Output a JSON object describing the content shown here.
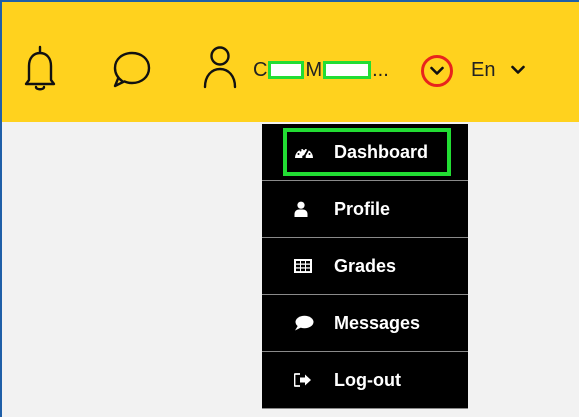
{
  "header": {
    "icons": {
      "notifications": "bell-icon",
      "messages": "speech-bubble-icon",
      "user": "user-icon"
    },
    "user_name_first_initial": "C",
    "user_name_last_initial": "M",
    "user_name_ellipsis": "...",
    "user_dropdown_icon": "chevron-down-icon",
    "language": "En",
    "language_dropdown_icon": "chevron-down-icon"
  },
  "menu": {
    "items": [
      {
        "label": "Dashboard",
        "icon": "dashboard-icon"
      },
      {
        "label": "Profile",
        "icon": "user-icon"
      },
      {
        "label": "Grades",
        "icon": "table-icon"
      },
      {
        "label": "Messages",
        "icon": "comment-icon"
      },
      {
        "label": "Log-out",
        "icon": "sign-out-icon"
      }
    ]
  },
  "colors": {
    "header_bg": "#ffd21e",
    "menu_bg": "#000000",
    "page_bg": "#f2f2f2",
    "highlight_green": "#22dd33",
    "highlight_red": "#e8241c"
  }
}
